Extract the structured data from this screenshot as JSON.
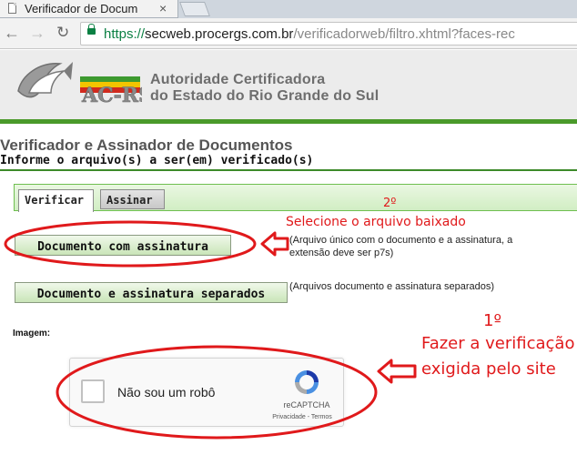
{
  "browser": {
    "tab_title": "Verificador de Docum",
    "tab_close": "×",
    "url_scheme": "https://",
    "url_host": "secweb.procergs.com.br",
    "url_path": "/verificadorweb/filtro.xhtml?faces-rec"
  },
  "site": {
    "logo_text": "AC-RS",
    "org_line1": "Autoridade Certificadora",
    "org_line2": "do Estado do Rio Grande do Sul",
    "accent_color": "#4a9a2a"
  },
  "page": {
    "title": "Verificador e Assinador de Documentos",
    "subtitle": "Informe o arquivo(s) a ser(em) verificado(s)",
    "tabs": [
      {
        "label": "Verificar",
        "active": true
      },
      {
        "label": "Assinar",
        "active": false
      }
    ],
    "buttons": {
      "with_signature": "Documento com assinatura",
      "separate": "Documento e assinatura separados"
    },
    "notes": {
      "with_signature_line1": "(Arquivo único com o documento e a assinatura, a",
      "with_signature_line2": "extensão deve ser p7s)",
      "separate": "(Arquivos documento e assinatura separados)"
    },
    "image_label": "Imagem:"
  },
  "recaptcha": {
    "label": "Não sou um robô",
    "brand": "reCAPTCHA",
    "links": "Privacidade - Termos"
  },
  "annotations": {
    "step2_number": "2º",
    "step2_text": "Selecione o arquivo baixado",
    "step1_number": "1º",
    "step1_text_line1": "Fazer a verificação",
    "step1_text_line2": "exigida pelo site",
    "color": "#e0191b"
  }
}
